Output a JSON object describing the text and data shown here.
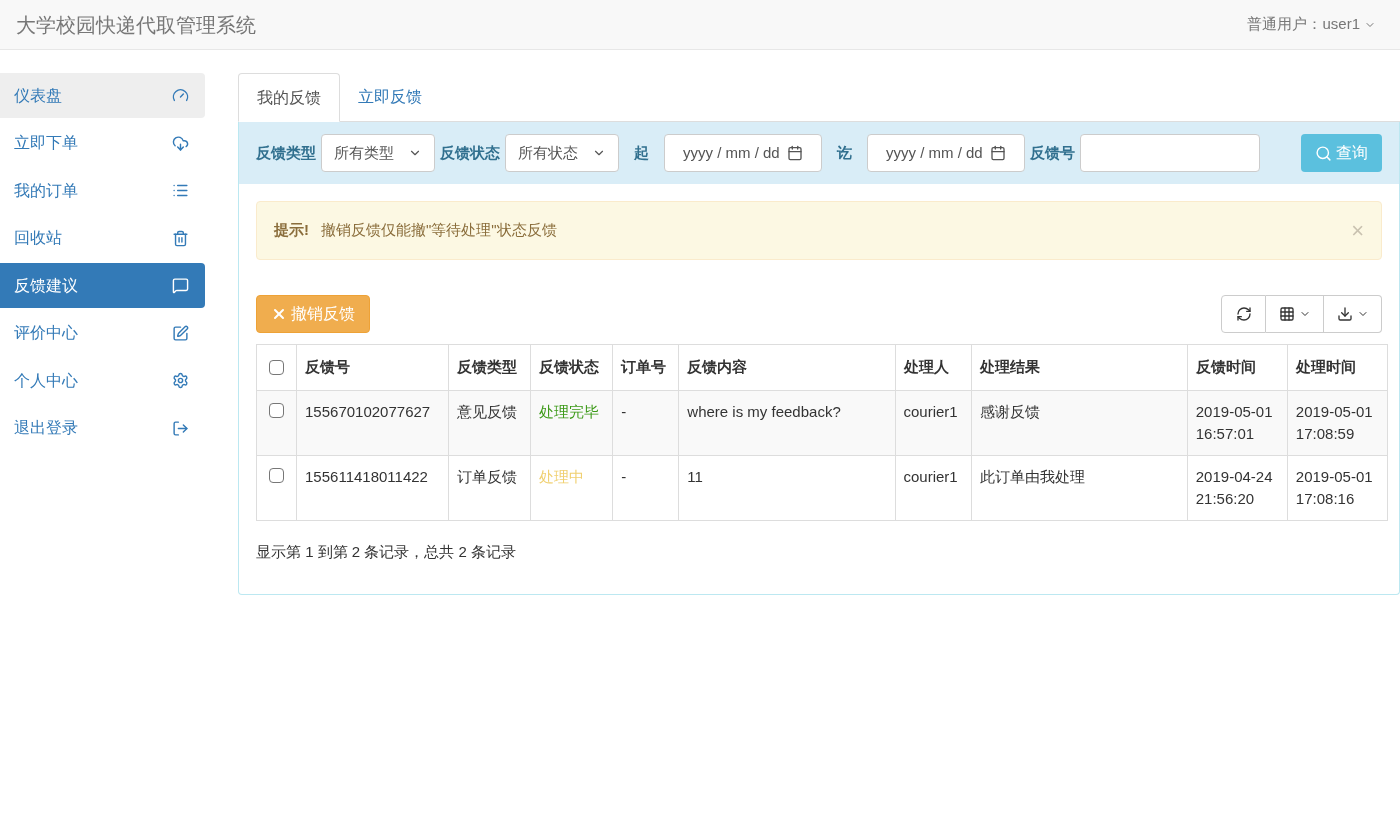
{
  "header": {
    "title": "大学校园快递代取管理系统",
    "user_menu": "普通用户：user1"
  },
  "sidebar": {
    "items": [
      {
        "label": "仪表盘",
        "selected": false,
        "hovered": true
      },
      {
        "label": "立即下单",
        "selected": false,
        "hovered": false
      },
      {
        "label": "我的订单",
        "selected": false,
        "hovered": false
      },
      {
        "label": "回收站",
        "selected": false,
        "hovered": false
      },
      {
        "label": "反馈建议",
        "selected": true,
        "hovered": false
      },
      {
        "label": "评价中心",
        "selected": false,
        "hovered": false
      },
      {
        "label": "个人中心",
        "selected": false,
        "hovered": false
      },
      {
        "label": "退出登录",
        "selected": false,
        "hovered": false
      }
    ]
  },
  "tabs": [
    {
      "label": "我的反馈",
      "selected": true
    },
    {
      "label": "立即反馈",
      "selected": false
    }
  ],
  "filters": [
    {
      "kind": "select",
      "label": "反馈类型",
      "value": "所有类型"
    },
    {
      "kind": "select",
      "label": "反馈状态",
      "value": "所有状态"
    },
    {
      "kind": "date",
      "label": "起",
      "value": "yyyy / mm / dd"
    },
    {
      "kind": "date",
      "label": "讫",
      "value": "yyyy / mm / dd"
    },
    {
      "kind": "text",
      "label": "反馈号"
    }
  ],
  "search_button": "查询",
  "alert": {
    "title": "提示!",
    "message": "撤销反馈仅能撤\"等待处理\"状态反馈",
    "close": "×"
  },
  "cancel_button": "撤销反馈",
  "table": {
    "all_checked": false,
    "columns": [
      "反馈号",
      "反馈类型",
      "反馈状态",
      "订单号",
      "反馈内容",
      "处理人",
      "处理结果",
      "反馈时间",
      "处理时间"
    ],
    "rows": [
      {
        "checked": false,
        "cells": [
          "155670102077627",
          "意见反馈",
          "处理完毕",
          "-",
          "where is my feedback?",
          "courier1",
          "感谢反馈",
          "2019-05-01 16:57:01",
          "2019-05-01 17:08:59"
        ],
        "color": "#3c9a18"
      },
      {
        "checked": false,
        "cells": [
          "155611418011422",
          "订单反馈",
          "处理中",
          "-",
          "11",
          "courier1",
          "此订单由我处理",
          "2019-04-24 21:56:20",
          "2019-05-01 17:08:16"
        ],
        "color": "#f0d070"
      }
    ]
  },
  "pagination_info": "显示第 1 到第 2 条记录，总共 2 条记录"
}
